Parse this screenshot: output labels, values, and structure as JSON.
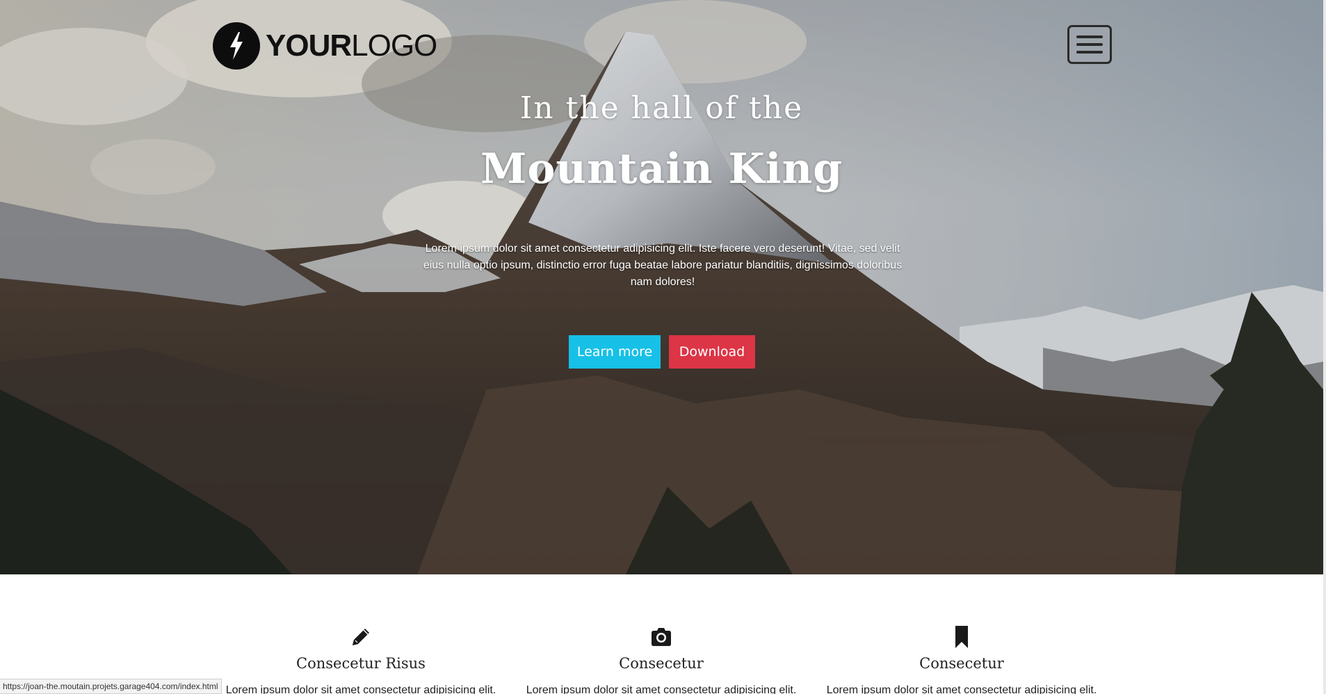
{
  "logo": {
    "bold": "YOUR",
    "light": "LOGO",
    "icon": "lightning-bolt-icon"
  },
  "header": {
    "menu_icon": "hamburger-menu-icon"
  },
  "hero": {
    "subtitle": "In the hall of the",
    "title": "Mountain King",
    "text": "Lorem ipsum dolor sit amet consectetur adipisicing elit. Iste facere vero deserunt! Vitae, sed velit eius nulla optio ipsum, distinctio error fuga beatae labore pariatur blanditiis, dignissimos doloribus nam dolores!",
    "learn_label": "Learn more",
    "download_label": "Download"
  },
  "features": [
    {
      "icon": "pencil-icon",
      "title": "Consecetur Risus",
      "text": "Lorem ipsum dolor sit amet consectetur adipisicing elit."
    },
    {
      "icon": "camera-icon",
      "title": "Consecetur",
      "text": "Lorem ipsum dolor sit amet consectetur adipisicing elit."
    },
    {
      "icon": "bookmark-icon",
      "title": "Consecetur",
      "text": "Lorem ipsum dolor sit amet consectetur adipisicing elit."
    }
  ],
  "status": {
    "url": "https://joan-the.moutain.projets.garage404.com/index.html"
  },
  "colors": {
    "learn_button": "#17c0e6",
    "download_button": "#dc3546",
    "text_dark": "#222222"
  }
}
